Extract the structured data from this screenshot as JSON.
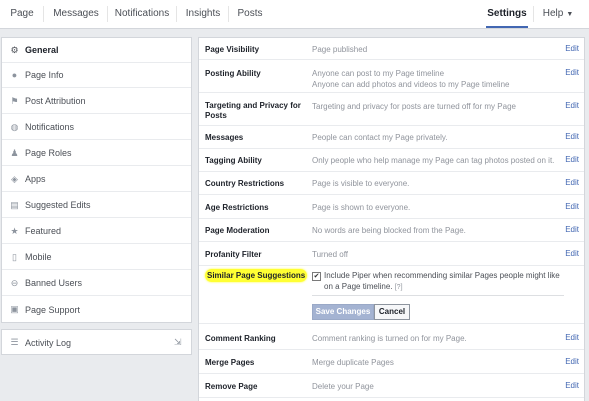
{
  "nav": {
    "tabs": [
      "Page",
      "Messages",
      "Notifications",
      "Insights",
      "Posts"
    ],
    "settings": "Settings",
    "help": "Help"
  },
  "sidebar": {
    "items": [
      {
        "label": "General",
        "icon": "gear-icon"
      },
      {
        "label": "Page Info",
        "icon": "info-icon"
      },
      {
        "label": "Post Attribution",
        "icon": "flag-icon"
      },
      {
        "label": "Notifications",
        "icon": "globe-icon"
      },
      {
        "label": "Page Roles",
        "icon": "person-icon"
      },
      {
        "label": "Apps",
        "icon": "apps-icon"
      },
      {
        "label": "Suggested Edits",
        "icon": "edits-icon"
      },
      {
        "label": "Featured",
        "icon": "star-icon"
      },
      {
        "label": "Mobile",
        "icon": "mobile-icon"
      },
      {
        "label": "Banned Users",
        "icon": "ban-icon"
      },
      {
        "label": "Page Support",
        "icon": "support-icon"
      }
    ],
    "activity_log": "Activity Log"
  },
  "settings": {
    "edit": "Edit",
    "rows": [
      {
        "name": "Page Visibility",
        "value": "Page published"
      },
      {
        "name": "Posting Ability",
        "value": "Anyone can post to my Page timeline",
        "value2": "Anyone can add photos and videos to my Page timeline"
      },
      {
        "name": "Targeting and Privacy for Posts",
        "value": "Targeting and privacy for posts are turned off for my Page"
      },
      {
        "name": "Messages",
        "value": "People can contact my Page privately."
      },
      {
        "name": "Tagging Ability",
        "value": "Only people who help manage my Page can tag photos posted on it."
      },
      {
        "name": "Country Restrictions",
        "value": "Page is visible to everyone."
      },
      {
        "name": "Age Restrictions",
        "value": "Page is shown to everyone."
      },
      {
        "name": "Page Moderation",
        "value": "No words are being blocked from the Page."
      },
      {
        "name": "Profanity Filter",
        "value": "Turned off"
      }
    ],
    "similar": {
      "name": "Similar Page Suggestions",
      "text": "Include Piper when recommending similar Pages people might like on a Page timeline.",
      "help": "[?]",
      "save": "Save Changes",
      "cancel": "Cancel",
      "highlight_color": "#ffff33"
    },
    "rows_after": [
      {
        "name": "Comment Ranking",
        "value": "Comment ranking is turned on for my Page."
      },
      {
        "name": "Merge Pages",
        "value": "Merge duplicate Pages"
      },
      {
        "name": "Remove Page",
        "value": "Delete your Page"
      }
    ]
  },
  "colors": {
    "link": "#4267b2",
    "active_tab": "#4267b2"
  }
}
